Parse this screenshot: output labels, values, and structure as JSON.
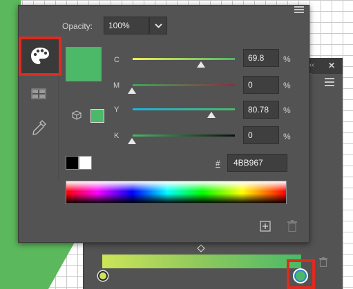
{
  "colors": {
    "current": "#4BB967",
    "panel_bg": "#535353",
    "highlight": "#E02A1E",
    "gradient_start": "#CDE45A",
    "gradient_end": "#4BB967"
  },
  "opacity": {
    "label": "Opacity:",
    "value": "100%",
    "dropdown_icon": "chevron-down-icon"
  },
  "cmyk": {
    "c": {
      "label": "C",
      "value": "69.8",
      "unit": "%",
      "fraction": 0.698
    },
    "m": {
      "label": "M",
      "value": "0",
      "unit": "%",
      "fraction": 0
    },
    "y": {
      "label": "Y",
      "value": "80.78",
      "unit": "%",
      "fraction": 0.8078
    },
    "k": {
      "label": "K",
      "value": "0",
      "unit": "%",
      "fraction": 0
    }
  },
  "hex": {
    "symbol": "#",
    "value": "4BB967"
  },
  "toolbar": {
    "color_mode_icon": "palette-icon",
    "swatches_icon": "swatches-grid-icon",
    "eyedropper_icon": "eyedropper-icon"
  },
  "icons": {
    "panel_menu": "hamburger-menu-icon",
    "gamut": "cube-icon",
    "new_swatch": "plus-square-icon",
    "delete_swatch": "trash-icon",
    "back_collapse": "double-chevron-icon",
    "back_close": "close-icon"
  },
  "back_panel": {
    "collapse_glyph": "‹‹",
    "close_glyph": "✕"
  }
}
